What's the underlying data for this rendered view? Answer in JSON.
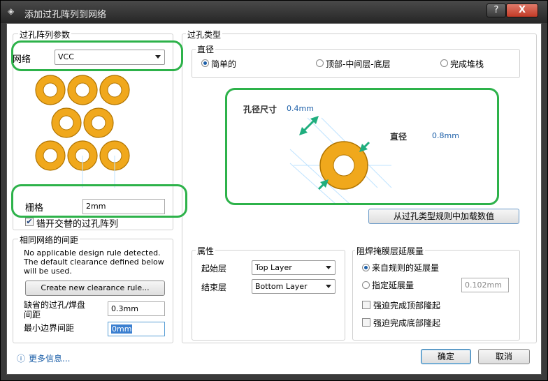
{
  "window": {
    "title": "添加过孔阵列到网络",
    "help_label": "?",
    "close_label": "X"
  },
  "array_params": {
    "group_label": "过孔阵列参数",
    "net_label": "网络",
    "net_value": "VCC",
    "grid_label": "栅格",
    "grid_value": "2mm",
    "stagger_label": "错开交替的过孔阵列",
    "stagger_checked": true
  },
  "clearance": {
    "group_label": "相同网络的间距",
    "message": "No applicable design rule detected. The default clearance defined below will be used.",
    "create_rule_label": "Create new clearance rule...",
    "missing_label": "缺省的过孔/焊盘间距",
    "missing_value": "0.3mm",
    "min_edge_label": "最小边界间距",
    "min_edge_value": "0mm"
  },
  "via_type": {
    "group_label": "过孔类型",
    "diameter_group_label": "直径",
    "options": [
      "简单的",
      "顶部-中间层-底层",
      "完成堆栈"
    ],
    "selected": 0,
    "hole_size_label": "孔径尺寸",
    "hole_size_value": "0.4mm",
    "diameter_label": "直径",
    "diameter_value": "0.8mm",
    "load_rule_label": "从过孔类型规则中加载数值"
  },
  "properties": {
    "group_label": "属性",
    "start_layer_label": "起始层",
    "start_layer_value": "Top Layer",
    "end_layer_label": "结束层",
    "end_layer_value": "Bottom Layer"
  },
  "solder_mask": {
    "group_label": "阻焊掩膜层延展量",
    "from_rule_label": "来自规则的延展量",
    "specify_label": "指定延展量",
    "specify_value": "0.102mm",
    "force_top_label": "强迫完成顶部隆起",
    "force_bottom_label": "强迫完成底部隆起"
  },
  "footer": {
    "more_info_label": "更多信息...",
    "ok_label": "确定",
    "cancel_label": "取消"
  },
  "colors": {
    "via_ring": "#f0a81c",
    "highlight": "#2db24a",
    "dimension_arrow": "#1fae7e"
  }
}
